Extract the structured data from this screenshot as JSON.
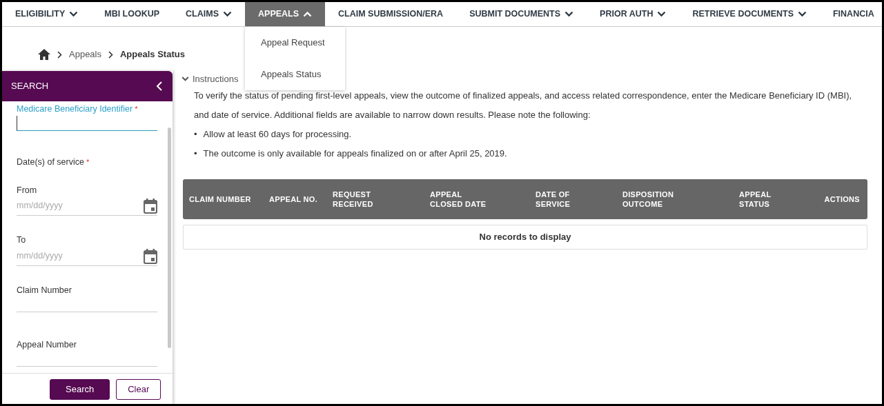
{
  "nav": {
    "items": [
      {
        "label": "ELIGIBILITY",
        "expanded": false,
        "selected": false
      },
      {
        "label": "MBI LOOKUP",
        "selected": false
      },
      {
        "label": "CLAIMS",
        "expanded": false,
        "selected": false
      },
      {
        "label": "APPEALS",
        "expanded": true,
        "selected": true,
        "menu": [
          "Appeal Request",
          "Appeals Status"
        ]
      },
      {
        "label": "CLAIM SUBMISSION/ERA",
        "selected": false
      },
      {
        "label": "SUBMIT DOCUMENTS",
        "expanded": false,
        "selected": false
      },
      {
        "label": "PRIOR AUTH",
        "expanded": false,
        "selected": false
      },
      {
        "label": "RETRIEVE DOCUMENTS",
        "expanded": false,
        "selected": false
      },
      {
        "label": "FINANCIA",
        "selected": false
      }
    ]
  },
  "breadcrumb": [
    {
      "label": "Appeals",
      "current": false
    },
    {
      "label": "Appeals Status",
      "current": true
    }
  ],
  "sidebar": {
    "title": "SEARCH",
    "fields": [
      {
        "kind": "text",
        "label": "Medicare Beneficiary Identifier",
        "required_mark": "*",
        "focused": true
      },
      {
        "kind": "heading",
        "label": "Date(s) of service",
        "required_mark": "*"
      },
      {
        "kind": "date",
        "label": "From",
        "focused": false,
        "placeholder": "mm/dd/yyyy"
      },
      {
        "kind": "date",
        "label": "To",
        "focused": false,
        "placeholder": "mm/dd/yyyy"
      },
      {
        "kind": "text",
        "label": "Claim Number",
        "focused": false
      },
      {
        "kind": "text",
        "label": "Appeal Number",
        "focused": false
      }
    ],
    "buttons": [
      {
        "label": "Search",
        "kind": "primary"
      },
      {
        "label": "Clear",
        "kind": "outline"
      }
    ]
  },
  "instructions": {
    "label": "Instructions",
    "expanded": true,
    "paragraph": "To verify the status of pending first-level appeals, view the outcome of finalized appeals, and access related correspondence, enter the Medicare Beneficiary ID (MBI), and date of service. Additional fields are available to narrow down results. Please note the following:",
    "bullets": [
      {
        "marker": "•",
        "text": "Allow at least 60 days for processing."
      },
      {
        "marker": "•",
        "text": "The outcome is only available for appeals finalized on or after April 25, 2019."
      }
    ]
  },
  "table": {
    "columns": [
      "CLAIM NUMBER",
      "APPEAL NO.",
      "REQUEST RECEIVED",
      "APPEAL CLOSED DATE",
      "DATE OF SERVICE",
      "DISPOSITION OUTCOME",
      "APPEAL STATUS",
      "ACTIONS"
    ],
    "empty_message": "No records to display"
  }
}
